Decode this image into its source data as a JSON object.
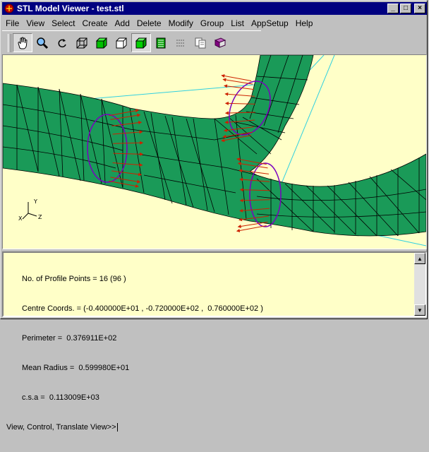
{
  "window": {
    "title": "STL Model Viewer - test.stl",
    "controls": {
      "minimize": "_",
      "maximize": "□",
      "close": "×"
    }
  },
  "menu": [
    "File",
    "View",
    "Select",
    "Create",
    "Add",
    "Delete",
    "Modify",
    "Group",
    "List",
    "AppSetup",
    "Help"
  ],
  "toolbar": {
    "tools": [
      {
        "icon": "hand-pan-icon",
        "pressed": true
      },
      {
        "icon": "magnifier-zoom-icon",
        "pressed": false
      },
      {
        "icon": "rotate-icon",
        "pressed": false
      },
      {
        "icon": "wireframe-cube-icon",
        "pressed": false
      },
      {
        "icon": "shaded-cube-icon",
        "pressed": false
      },
      {
        "icon": "hidden-line-cube-icon",
        "pressed": false
      },
      {
        "icon": "solid-cube-icon",
        "pressed": true
      },
      {
        "icon": "table-list-icon",
        "pressed": false
      },
      {
        "icon": "disabled-tool-icon",
        "pressed": false
      },
      {
        "icon": "copy-icon",
        "pressed": false
      },
      {
        "icon": "book-icon",
        "pressed": false
      }
    ]
  },
  "viewport": {
    "axis_labels": {
      "y": "Y",
      "x": "X",
      "z": "Z"
    },
    "colors": {
      "background": "#ffffc8",
      "mesh": "#1a9a58",
      "vectors": "#cc2200",
      "profile": "#7a00c0",
      "guide": "#30d0e0"
    }
  },
  "console": {
    "lines": [
      "No. of Profile Points = 16 (96 )",
      "Centre Coords. = (-0.400000E+01 , -0.720000E+02 ,  0.760000E+02 )",
      "Perimeter =  0.376911E+02",
      "Mean Radius =  0.599980E+01",
      "c.s.a =  0.113009E+03"
    ],
    "prompt": "View, Control, Translate View>>"
  }
}
